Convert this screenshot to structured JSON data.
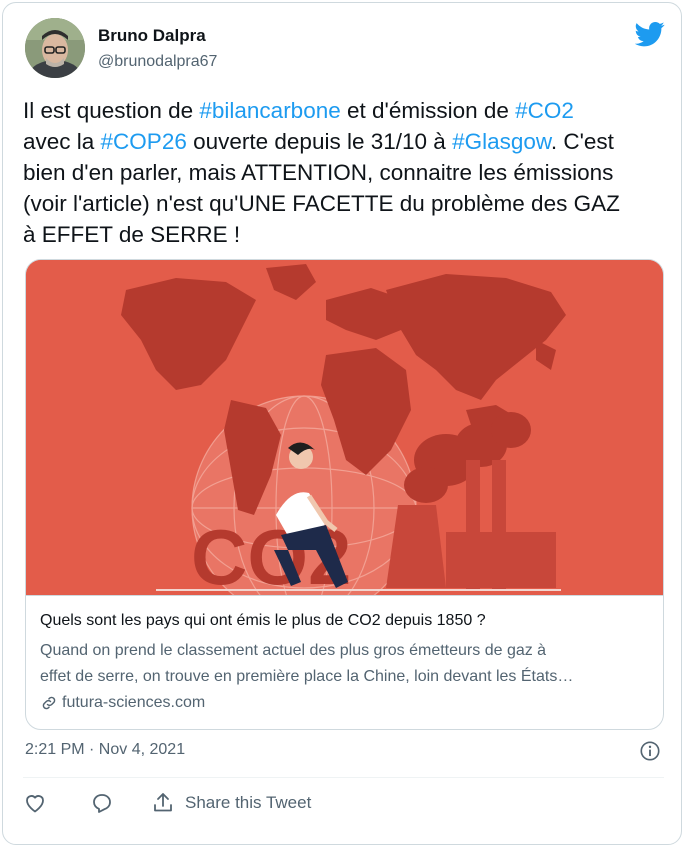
{
  "author": {
    "name": "Bruno Dalpra",
    "handle": "@brunodalpra67"
  },
  "icons": {
    "brand": "twitter-bird-icon",
    "info": "info-icon",
    "link": "link-icon",
    "like": "heart-icon",
    "reply": "reply-icon",
    "share": "share-icon"
  },
  "colors": {
    "accent": "#1d9bf0",
    "card_image_bg": "#e35c4a"
  },
  "tweet": {
    "segments": [
      {
        "text": "Il est question de "
      },
      {
        "text": "#bilancarbone",
        "tag": true
      },
      {
        "text": " et d'émission de "
      },
      {
        "text": "#CO2",
        "tag": true
      },
      {
        "text": "\navec la "
      },
      {
        "text": "#COP26",
        "tag": true
      },
      {
        "text": " ouverte depuis le 31/10 à "
      },
      {
        "text": "#Glasgow",
        "tag": true
      },
      {
        "text": ". C'est\nbien d'en parler, mais ATTENTION, connaitre les émissions\n(voir l'article) n'est qu'UNE FACETTE du problème des GAZ\nà EFFET de SERRE !"
      }
    ]
  },
  "card": {
    "image_text": "CO2",
    "title": "Quels sont les pays qui ont émis le plus de CO2 depuis 1850 ?",
    "description_line1": "Quand on prend le classement actuel des plus gros émetteurs de gaz à",
    "description_line2": "effet de serre, on trouve en première place la Chine, loin devant les États…",
    "domain": "futura-sciences.com"
  },
  "meta": {
    "timestamp": "2:21 PM · Nov 4, 2021"
  },
  "actions": {
    "share_label": "Share this Tweet"
  }
}
